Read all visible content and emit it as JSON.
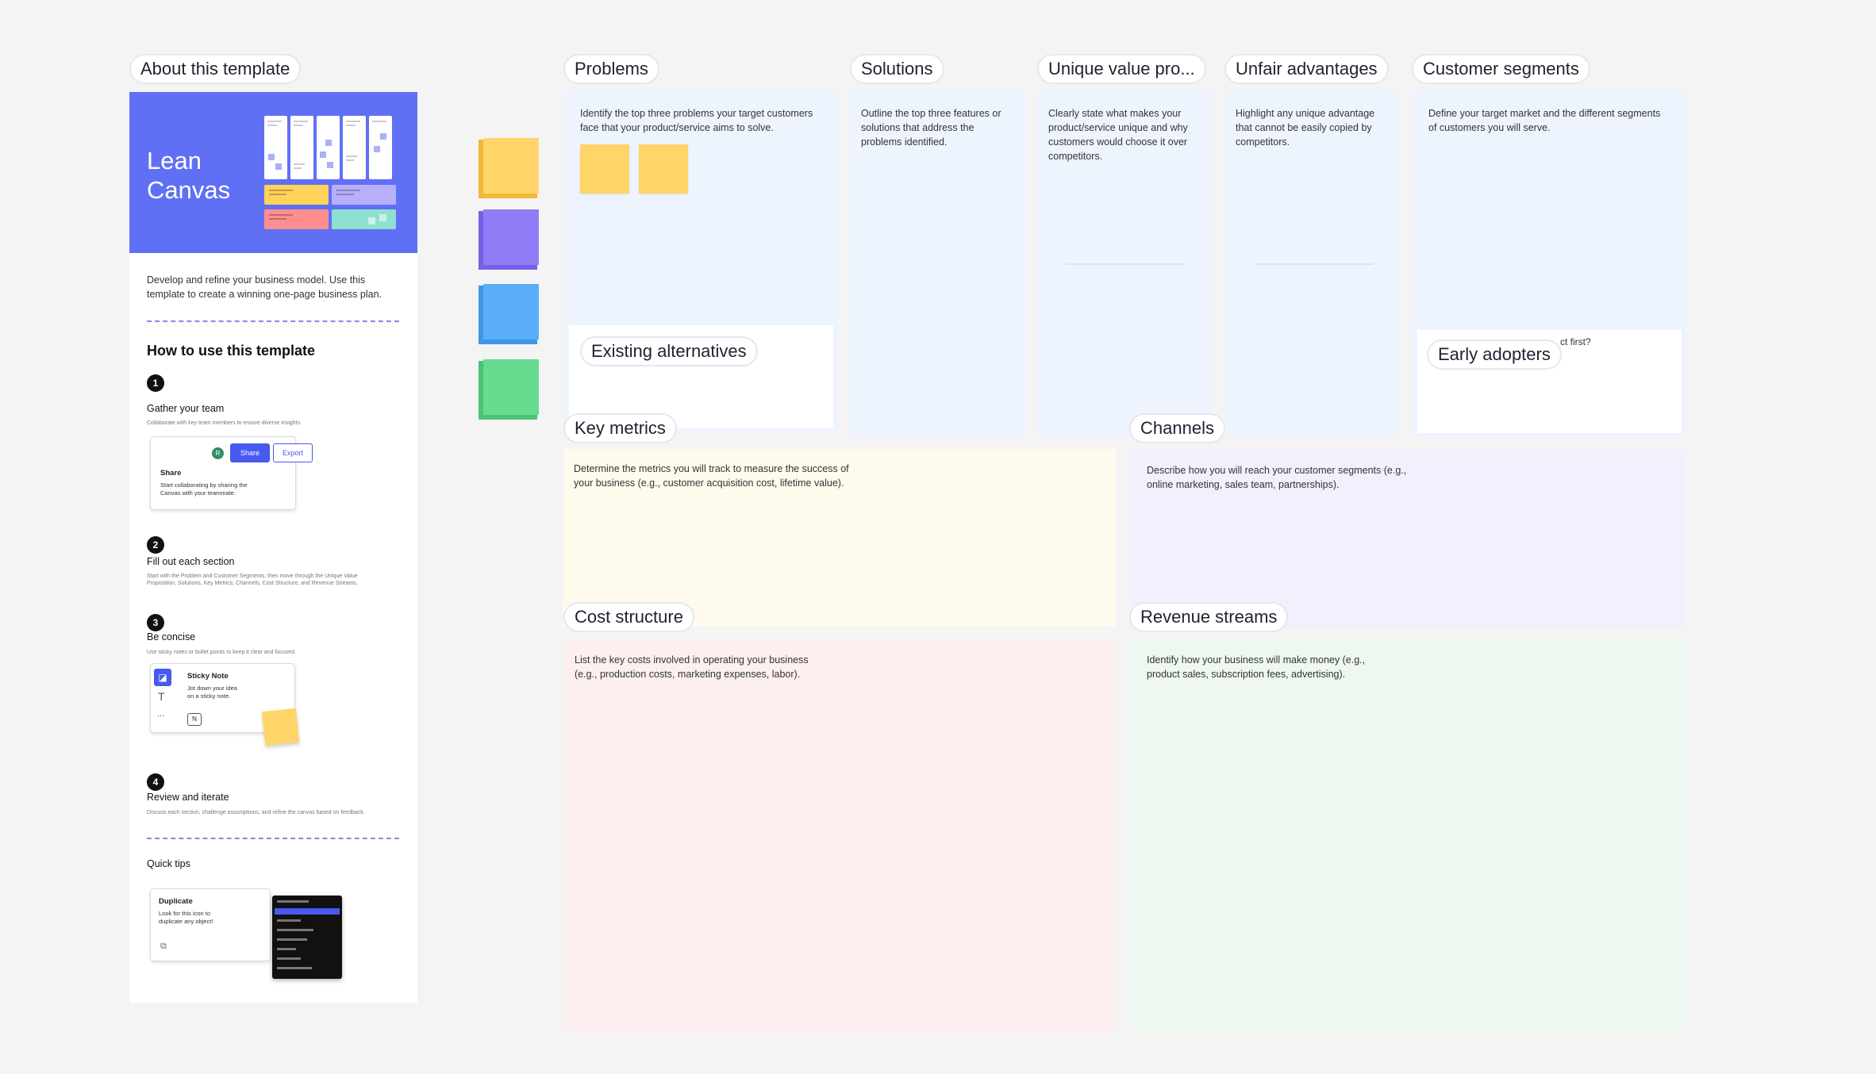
{
  "colors": {
    "hero": "#6070f5",
    "accent": "#4759ef",
    "note_yellow": "#ffd56a",
    "note_purple": "#8f7cf6",
    "note_blue": "#5aaef7",
    "note_green": "#67db8f",
    "frame_blue": "#eef4fd",
    "frame_yellow": "#fefbec",
    "frame_lavender": "#f1f0fd",
    "frame_pink": "#fdeff0",
    "frame_green": "#eef8f0"
  },
  "about": {
    "label": "About this template",
    "hero_title": "Lean\nCanvas",
    "description": "Develop and refine your business model. Use this template to create a winning one-page business plan.",
    "howto_title": "How to use this template",
    "steps": [
      {
        "num": "1",
        "title": "Gather your team",
        "desc": "Collaborate with key team members to ensure diverse insights."
      },
      {
        "num": "2",
        "title": "Fill out each section",
        "desc": "Start with the Problem and Customer Segments, then move through the Unique Value Proposition, Solutions, Key Metrics, Channels, Cost Structure, and Revenue Streams."
      },
      {
        "num": "3",
        "title": "Be concise",
        "desc": "Use sticky notes or bullet points to keep it clear and focused."
      },
      {
        "num": "4",
        "title": "Review and iterate",
        "desc": "Discuss each section, challenge assumptions, and refine the canvas based on feedback."
      }
    ],
    "share_card": {
      "avatar": "R",
      "share": "Share",
      "export": "Export",
      "title": "Share",
      "desc": "Start collaborating by sharing the Canvas with your teammate."
    },
    "sticky_card": {
      "title": "Sticky Note",
      "desc": "Jot down your idea on a sticky note.",
      "shortcut": "N",
      "text_tool": "T",
      "more": "..."
    },
    "quick_tips": "Quick tips",
    "dup_card": {
      "title": "Duplicate",
      "desc": "Look for this icon to duplicate any object!"
    }
  },
  "frames": {
    "problems": {
      "label": "Problems",
      "desc": "Identify the top three problems your target customers face that your product/service aims to solve."
    },
    "existing_alternatives": {
      "label": "Existing alternatives"
    },
    "solutions": {
      "label": "Solutions",
      "desc": "Outline the top three features or solutions that address the problems identified."
    },
    "uvp": {
      "label": "Unique value pro...",
      "desc": "Clearly state what makes your product/service unique and why customers would choose it over competitors."
    },
    "unfair": {
      "label": "Unfair advantages",
      "desc": "Highlight any unique advantage that cannot be easily copied by competitors."
    },
    "segments": {
      "label": "Customer segments",
      "desc": "Define your target market and the different segments of customers you will serve."
    },
    "early_adopters": {
      "label": "Early adopters",
      "partial_text": "ct first?"
    },
    "key_metrics": {
      "label": "Key metrics",
      "desc": "Determine the metrics you will track to measure the success of your business (e.g., customer acquisition cost, lifetime value)."
    },
    "channels": {
      "label": "Channels",
      "desc": "Describe how you will reach your customer segments (e.g., online marketing, sales team, partnerships)."
    },
    "cost": {
      "label": "Cost structure",
      "desc": "List the key costs involved in operating your business (e.g., production costs, marketing expenses, labor)."
    },
    "revenue": {
      "label": "Revenue streams",
      "desc": "Identify how your business will make money (e.g., product sales, subscription fees, advertising)."
    }
  }
}
